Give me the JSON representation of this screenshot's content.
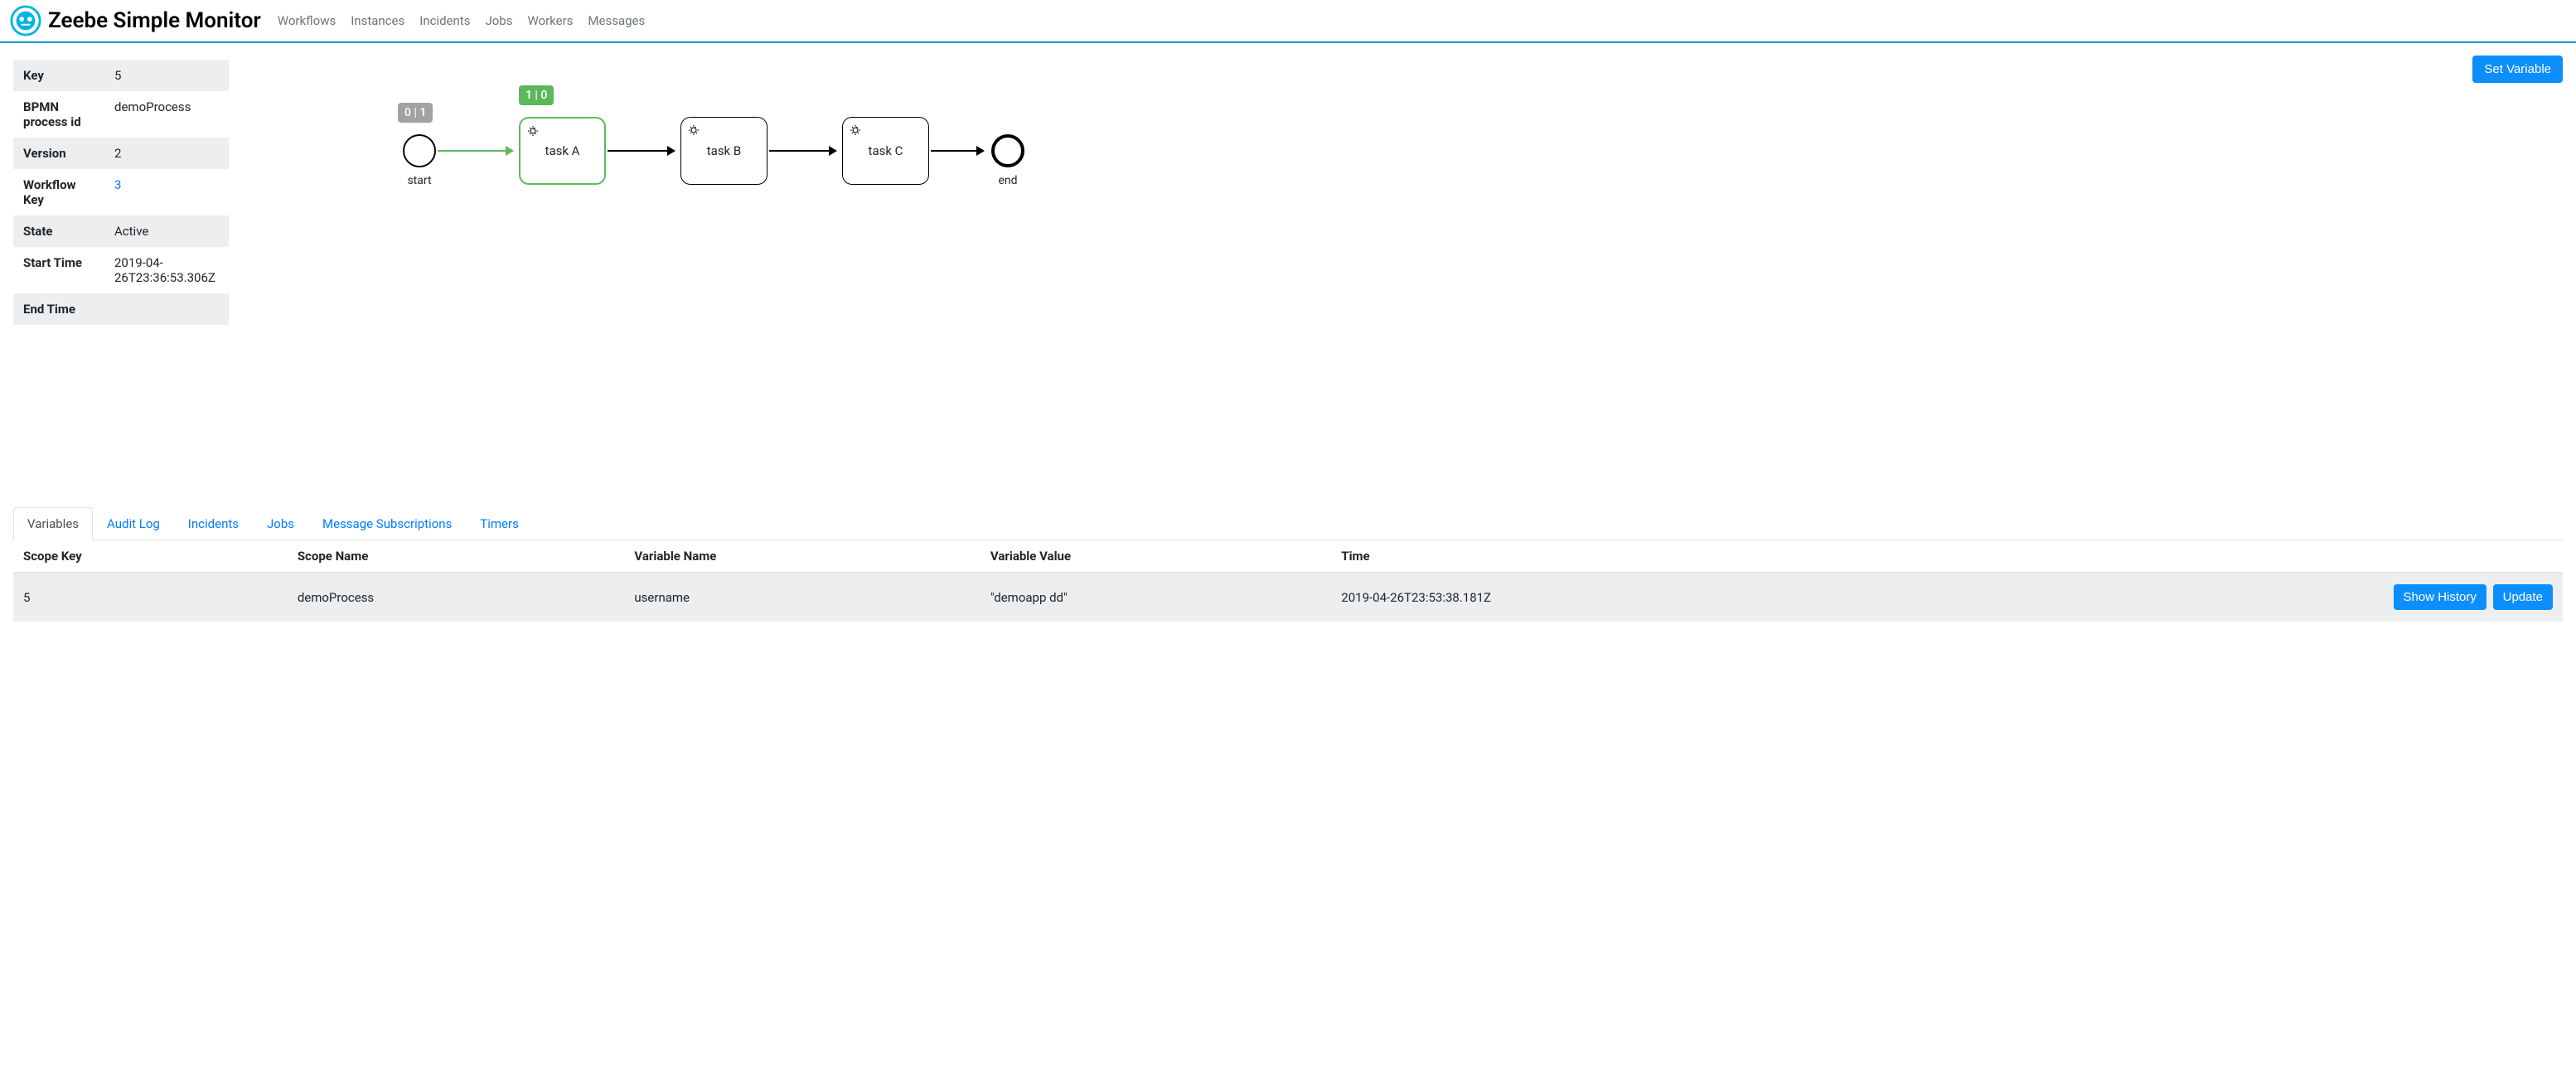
{
  "app_title": "Zeebe Simple Monitor",
  "nav": {
    "workflows": "Workflows",
    "instances": "Instances",
    "incidents": "Incidents",
    "jobs": "Jobs",
    "workers": "Workers",
    "messages": "Messages"
  },
  "actions": {
    "set_variable": "Set Variable",
    "show_history": "Show History",
    "update": "Update"
  },
  "info": {
    "key_label": "Key",
    "key_value": "5",
    "bpmn_label": "BPMN process id",
    "bpmn_value": "demoProcess",
    "version_label": "Version",
    "version_value": "2",
    "wfkey_label": "Workflow Key",
    "wfkey_value": "3",
    "state_label": "State",
    "state_value": "Active",
    "start_label": "Start Time",
    "start_value": "2019-04-26T23:36:53.306Z",
    "end_label": "End Time",
    "end_value": ""
  },
  "diagram": {
    "start_label": "start",
    "start_badge": "0 | 1",
    "task_a_label": "task A",
    "task_a_badge": "1 | 0",
    "task_b_label": "task B",
    "task_c_label": "task C",
    "end_label": "end"
  },
  "tabs": {
    "variables": "Variables",
    "audit_log": "Audit Log",
    "incidents": "Incidents",
    "jobs": "Jobs",
    "message_subs": "Message Subscriptions",
    "timers": "Timers"
  },
  "table": {
    "headers": {
      "scope_key": "Scope Key",
      "scope_name": "Scope Name",
      "var_name": "Variable Name",
      "var_value": "Variable Value",
      "time": "Time"
    },
    "rows": [
      {
        "scope_key": "5",
        "scope_name": "demoProcess",
        "var_name": "username",
        "var_value": "\"demoapp dd\"",
        "time": "2019-04-26T23:53:38.181Z"
      }
    ]
  }
}
